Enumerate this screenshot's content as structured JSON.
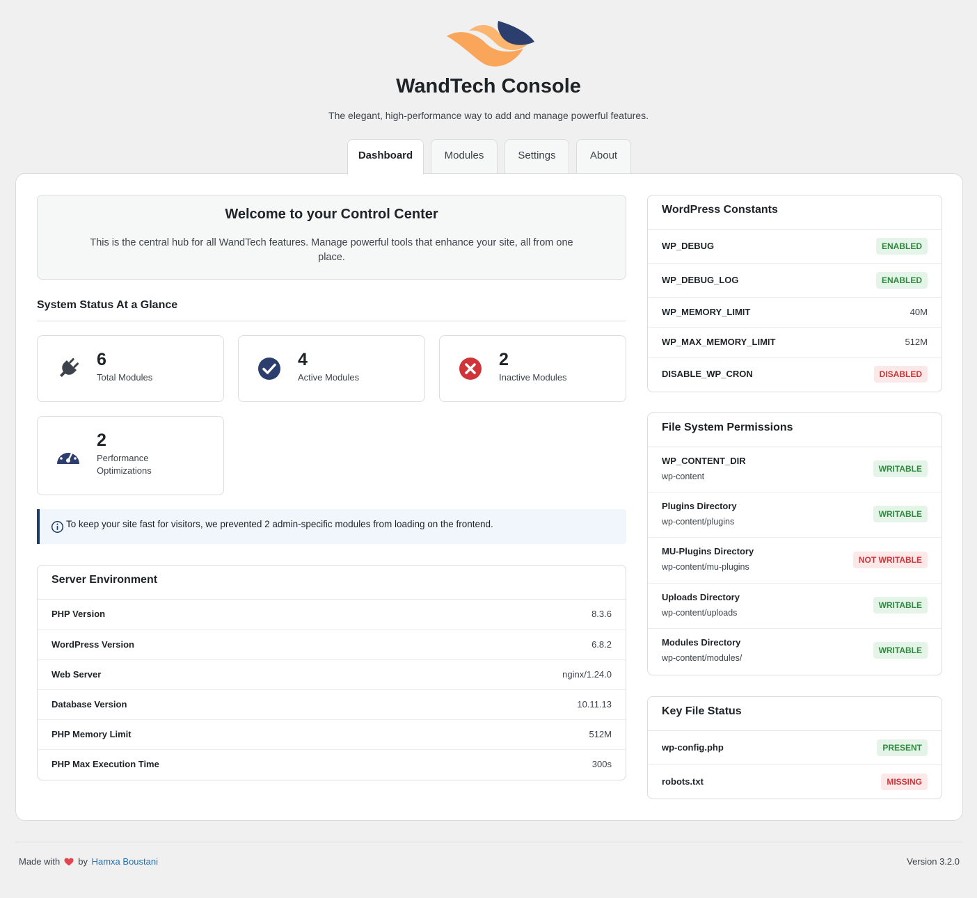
{
  "header": {
    "title": "WandTech Console",
    "tagline": "The elegant, high-performance way to add and manage powerful features."
  },
  "tabs": [
    {
      "label": "Dashboard",
      "active": true
    },
    {
      "label": "Modules",
      "active": false
    },
    {
      "label": "Settings",
      "active": false
    },
    {
      "label": "About",
      "active": false
    }
  ],
  "welcome": {
    "title": "Welcome to your Control Center",
    "text": "This is the central hub for all WandTech features. Manage powerful tools that enhance your site, all from one place."
  },
  "status": {
    "heading": "System Status At a Glance",
    "cards": [
      {
        "value": "6",
        "label": "Total Modules",
        "icon": "plug-icon"
      },
      {
        "value": "4",
        "label": "Active Modules",
        "icon": "check-circle-icon"
      },
      {
        "value": "2",
        "label": "Inactive Modules",
        "icon": "x-circle-icon"
      },
      {
        "value": "2",
        "label": "Performance Optimizations",
        "icon": "gauge-icon"
      }
    ]
  },
  "notice": {
    "text": "To keep your site fast for visitors, we prevented 2 admin-specific modules from loading on the frontend.",
    "icon": "info-icon"
  },
  "server": {
    "title": "Server Environment",
    "rows": [
      {
        "label": "PHP Version",
        "value": "8.3.6"
      },
      {
        "label": "WordPress Version",
        "value": "6.8.2"
      },
      {
        "label": "Web Server",
        "value": "nginx/1.24.0"
      },
      {
        "label": "Database Version",
        "value": "10.11.13"
      },
      {
        "label": "PHP Memory Limit",
        "value": "512M"
      },
      {
        "label": "PHP Max Execution Time",
        "value": "300s"
      }
    ]
  },
  "constants": {
    "title": "WordPress Constants",
    "rows": [
      {
        "label": "WP_DEBUG",
        "badge": "ENABLED",
        "status": "ok"
      },
      {
        "label": "WP_DEBUG_LOG",
        "badge": "ENABLED",
        "status": "ok"
      },
      {
        "label": "WP_MEMORY_LIMIT",
        "value": "40M"
      },
      {
        "label": "WP_MAX_MEMORY_LIMIT",
        "value": "512M"
      },
      {
        "label": "DISABLE_WP_CRON",
        "badge": "DISABLED",
        "status": "bad"
      }
    ]
  },
  "permissions": {
    "title": "File System Permissions",
    "rows": [
      {
        "label": "WP_CONTENT_DIR",
        "path": "wp-content",
        "badge": "WRITABLE",
        "status": "ok"
      },
      {
        "label": "Plugins Directory",
        "path": "wp-content/plugins",
        "badge": "WRITABLE",
        "status": "ok"
      },
      {
        "label": "MU-Plugins Directory",
        "path": "wp-content/mu-plugins",
        "badge": "NOT WRITABLE",
        "status": "bad"
      },
      {
        "label": "Uploads Directory",
        "path": "wp-content/uploads",
        "badge": "WRITABLE",
        "status": "ok"
      },
      {
        "label": "Modules Directory",
        "path": "wp-content/modules/",
        "badge": "WRITABLE",
        "status": "ok"
      }
    ]
  },
  "keyfiles": {
    "title": "Key File Status",
    "rows": [
      {
        "label": "wp-config.php",
        "badge": "PRESENT",
        "status": "ok"
      },
      {
        "label": "robots.txt",
        "badge": "MISSING",
        "status": "bad"
      }
    ]
  },
  "footer": {
    "made_with": "Made with",
    "by": "by",
    "author": "Hamxa Boustani",
    "version": "Version 3.2.0"
  },
  "colors": {
    "brand_orange": "#f9a65a",
    "brand_navy": "#2c3e6d",
    "success": "#2f8a3e",
    "danger": "#d13438",
    "link": "#2271b1"
  }
}
